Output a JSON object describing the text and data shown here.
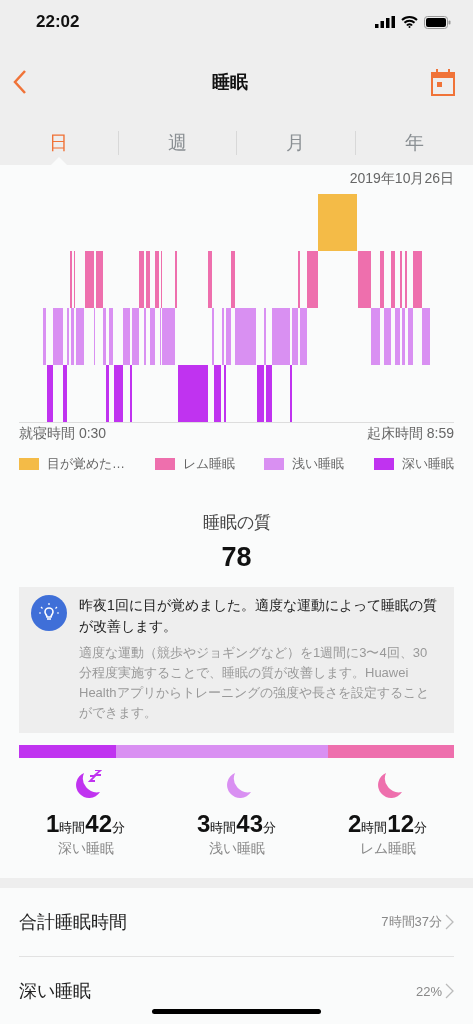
{
  "status_bar": {
    "time": "22:02"
  },
  "nav": {
    "title": "睡眠"
  },
  "tabs": [
    {
      "label": "日",
      "selected": true
    },
    {
      "label": "週",
      "selected": false
    },
    {
      "label": "月",
      "selected": false
    },
    {
      "label": "年",
      "selected": false
    }
  ],
  "date": "2019年10月26日",
  "chart": {
    "bedtime": "就寝時間 0:30",
    "wake_time": "起床時間 8:59"
  },
  "legend": [
    {
      "label": "目が覚めた…",
      "color": "#f4bb47"
    },
    {
      "label": "レム睡眠",
      "color": "#ee6fad"
    },
    {
      "label": "浅い睡眠",
      "color": "#d990f2"
    },
    {
      "label": "深い睡眠",
      "color": "#c033f0"
    }
  ],
  "quality": {
    "title": "睡眠の質",
    "score": "78"
  },
  "tip": {
    "headline": "昨夜1回に目が覚めました。適度な運動によって睡眠の質が改善します。",
    "body": "適度な運動（競歩やジョギングなど）を1週間に3〜4回、30分程度実施することで、睡眠の質が改善します。Huawei Healthアプリからトレーニングの強度や長さを設定することができます。"
  },
  "summary_bar": [
    {
      "color": "#c033f0"
    },
    {
      "color": "#d990f2"
    },
    {
      "color": "#ee6fad"
    }
  ],
  "stats": [
    {
      "kind": "moon-zzz",
      "color": "#c033f0",
      "value": "**1**時間**42**分",
      "label": "深い睡眠"
    },
    {
      "kind": "moon",
      "color": "#d990f2",
      "value": "**3**時間**43**分",
      "label": "浅い睡眠"
    },
    {
      "kind": "moon",
      "color": "#ee6fad",
      "value": "**2**時間**12**分",
      "label": "レム睡眠"
    }
  ],
  "rows": [
    {
      "label": "合計睡眠時間",
      "value": "7時間37分"
    },
    {
      "label": "深い睡眠",
      "value": "22%"
    }
  ]
}
